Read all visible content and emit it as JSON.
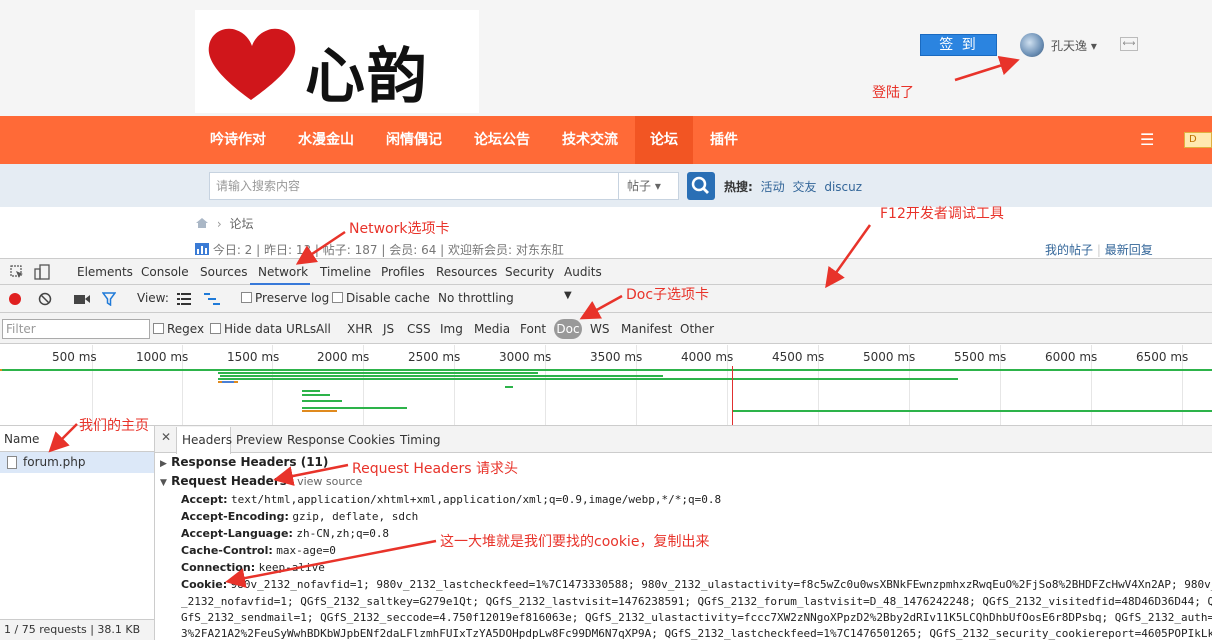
{
  "site": {
    "logo_text": "心韵",
    "checkin_label": "签 到",
    "username": "孔天逸 ▾",
    "expand_icon": "⟷",
    "nav_items": [
      "吟诗作对",
      "水漫金山",
      "闲情偶记",
      "论坛公告",
      "技术交流",
      "论坛",
      "插件"
    ],
    "nav_menu_icon": "☰",
    "nav_badge": "D",
    "search_placeholder": "请输入搜索内容",
    "search_select": "帖子 ▾",
    "hot_label": "热搜:",
    "hot_tags": [
      "活动",
      "交友",
      "discuz"
    ],
    "breadcrumb_sep": "›",
    "breadcrumb": "论坛",
    "stats": "今日: 2 | 昨日: 13 | 帖子: 187 | 会员: 64 | 欢迎新会员: 对东东肛",
    "my_posts": "我的帖子",
    "latest_replies": "最新回复",
    "accent": "#ff6a37"
  },
  "devtools": {
    "tabs": [
      "Elements",
      "Console",
      "Sources",
      "Network",
      "Timeline",
      "Profiles",
      "Resources",
      "Security",
      "Audits"
    ],
    "view_label": "View:",
    "preserve_log": "Preserve log",
    "disable_cache": "Disable cache",
    "throttling": "No throttling",
    "filter_placeholder": "Filter",
    "regex": "Regex",
    "hide_data_urls": "Hide data URLs",
    "filter_types": [
      "All",
      "XHR",
      "JS",
      "CSS",
      "Img",
      "Media",
      "Font",
      "Doc",
      "WS",
      "Manifest",
      "Other"
    ],
    "timeline_ticks": [
      "500 ms",
      "1000 ms",
      "1500 ms",
      "2000 ms",
      "2500 ms",
      "3000 ms",
      "3500 ms",
      "4000 ms",
      "4500 ms",
      "5000 ms",
      "5500 ms",
      "6000 ms",
      "6500 ms"
    ],
    "name_header": "Name",
    "request_file": "forum.php",
    "status_bar": "1 / 75 requests | 38.1 KB /...",
    "detail_tabs": [
      "Headers",
      "Preview",
      "Response",
      "Cookies",
      "Timing"
    ],
    "response_headers": "Response Headers (11)",
    "request_headers": "Request Headers",
    "view_source": "view source",
    "headers": [
      {
        "name": "Accept:",
        "value": "text/html,application/xhtml+xml,application/xml;q=0.9,image/webp,*/*;q=0.8"
      },
      {
        "name": "Accept-Encoding:",
        "value": "gzip, deflate, sdch"
      },
      {
        "name": "Accept-Language:",
        "value": "zh-CN,zh;q=0.8"
      },
      {
        "name": "Cache-Control:",
        "value": "max-age=0"
      },
      {
        "name": "Connection:",
        "value": "keep-alive"
      },
      {
        "name": "Cookie:",
        "value": "980v_2132_nofavfid=1; 980v_2132_lastcheckfeed=1%7C1473330588; 980v_2132_ulastactivity=f8c5wZc0u0wsXBNkFEwnzpmhxzRwqEuO%2FjSo8%2BHDFZcHwV4Xn2AP; 980v_2132_"
      }
    ],
    "cookie_lines": [
      "_2132_nofavfid=1; QGfS_2132_saltkey=G279e1Qt; QGfS_2132_lastvisit=1476238591; QGfS_2132_forum_lastvisit=D_48_1476242248; QGfS_2132_visitedfid=48D46D36D44; QGfS_",
      "GfS_2132_sendmail=1; QGfS_2132_seccode=4.750f12019ef816063e; QGfS_2132_ulastactivity=fccc7XW2zNNgoXPpzD2%2Bby2dRIv11K5LCQhDhbUfOosE6r8DPsbq; QGfS_2132_auth=88",
      "3%2FA21A2%2FeuSyWwhBDKbWJpbENf2daLFlzmhFUIxTzYA5DOHpdpLw8Fc99DM6N7qXP9A; QGfS_2132_lastcheckfeed=1%7C1476501265; QGfS_2132_security_cookiereport=4605POPIkLkyf"
    ]
  },
  "annotations": {
    "logged_in": "登陆了",
    "network_tab": "Network选项卡",
    "f12_tools": "F12开发者调试工具",
    "doc_tab": "Doc子选项卡",
    "our_homepage": "我们的主页",
    "request_headers_note": "Request Headers 请求头",
    "cookie_note": "这一大堆就是我们要找的cookie，复制出来"
  }
}
